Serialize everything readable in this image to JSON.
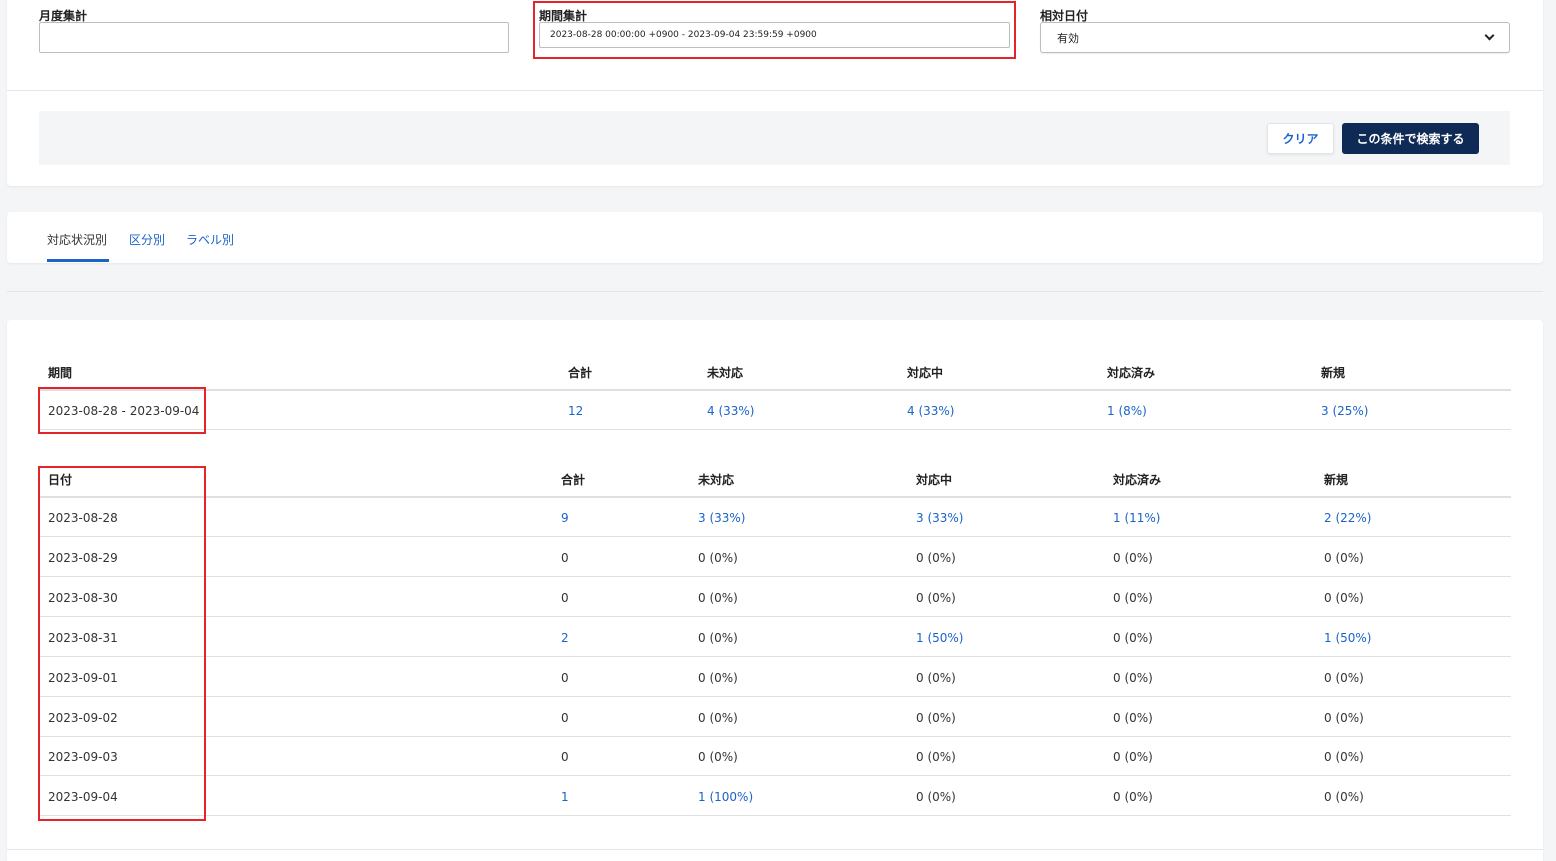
{
  "filters": {
    "monthly": {
      "label": "月度集計",
      "value": ""
    },
    "period": {
      "label": "期間集計",
      "value": "2023-08-28 00:00:00 +0900 - 2023-09-04 23:59:59 +0900"
    },
    "relative_date": {
      "label": "相対日付",
      "selected": "有効"
    },
    "clear_label": "クリア",
    "search_label": "この条件で検索する"
  },
  "tabs": [
    {
      "label": "対応状況別",
      "active": true
    },
    {
      "label": "区分別",
      "active": false
    },
    {
      "label": "ラベル別",
      "active": false
    }
  ],
  "summary": {
    "headers": [
      "期間",
      "合計",
      "未対応",
      "対応中",
      "対応済み",
      "新規"
    ],
    "row": [
      "2023-08-28 - 2023-09-04",
      "12",
      "4 (33%)",
      "4 (33%)",
      "1 (8%)",
      "3 (25%)"
    ]
  },
  "daily": {
    "headers": [
      "日付",
      "合計",
      "未対応",
      "対応中",
      "対応済み",
      "新規"
    ],
    "rows": [
      [
        "2023-08-28",
        "9",
        "3 (33%)",
        "3 (33%)",
        "1 (11%)",
        "2 (22%)"
      ],
      [
        "2023-08-29",
        "0",
        "0 (0%)",
        "0 (0%)",
        "0 (0%)",
        "0 (0%)"
      ],
      [
        "2023-08-30",
        "0",
        "0 (0%)",
        "0 (0%)",
        "0 (0%)",
        "0 (0%)"
      ],
      [
        "2023-08-31",
        "2",
        "0 (0%)",
        "1 (50%)",
        "0 (0%)",
        "1 (50%)"
      ],
      [
        "2023-09-01",
        "0",
        "0 (0%)",
        "0 (0%)",
        "0 (0%)",
        "0 (0%)"
      ],
      [
        "2023-09-02",
        "0",
        "0 (0%)",
        "0 (0%)",
        "0 (0%)",
        "0 (0%)"
      ],
      [
        "2023-09-03",
        "0",
        "0 (0%)",
        "0 (0%)",
        "0 (0%)",
        "0 (0%)"
      ],
      [
        "2023-09-04",
        "1",
        "1 (100%)",
        "0 (0%)",
        "0 (0%)",
        "0 (0%)"
      ]
    ]
  },
  "colors": {
    "link": "#1a63c9",
    "primary_button": "#0f2a55",
    "highlight": "#e3242b"
  }
}
